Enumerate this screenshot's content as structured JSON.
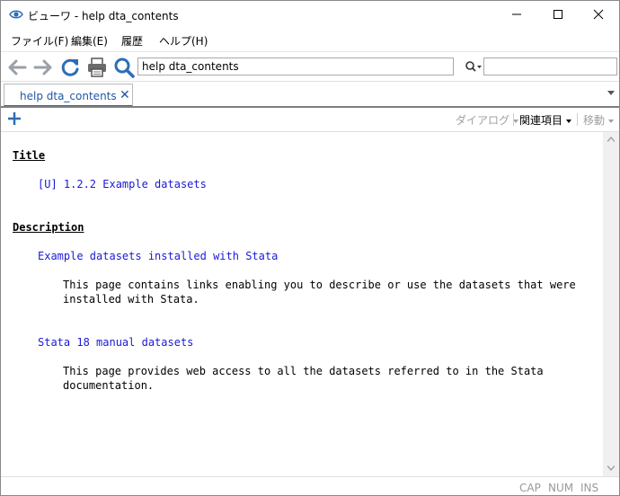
{
  "window": {
    "title": "ビューワ - help dta_contents",
    "icon": "eye-icon"
  },
  "menu": {
    "items": [
      {
        "label": "ファイル(F)"
      },
      {
        "label": "編集(E)"
      },
      {
        "label": "履歴"
      },
      {
        "label": "ヘルプ(H)"
      }
    ]
  },
  "toolbar": {
    "command_value": "help dta_contents",
    "find_value": "",
    "icons": [
      "back-arrow-icon",
      "forward-arrow-icon",
      "refresh-icon",
      "print-icon",
      "search-icon"
    ]
  },
  "tabs": [
    {
      "label": "help dta_contents",
      "close": "✕"
    }
  ],
  "subbar": {
    "dialog_label": "ダイアログ",
    "related_label": "関連項目",
    "jump_label": "移動"
  },
  "content": {
    "title_heading": "Title",
    "title_link": "[U] 1.2.2 Example datasets",
    "description_heading": "Description",
    "link1": "Example datasets installed with Stata",
    "link1_text_line1": "This page contains links enabling you to describe or use the datasets that were",
    "link1_text_line2": "installed with Stata.",
    "link2": "Stata 18 manual datasets",
    "link2_text_line1": "This page provides web access to all the datasets referred to in the Stata",
    "link2_text_line2": "documentation."
  },
  "status": {
    "cap": "CAP",
    "num": "NUM",
    "ins": "INS"
  },
  "colors": {
    "link": "#1a1ad6",
    "accent": "#2d6db5",
    "tab_text": "#1f57a4",
    "icon_gray": "#9aa0a6"
  }
}
